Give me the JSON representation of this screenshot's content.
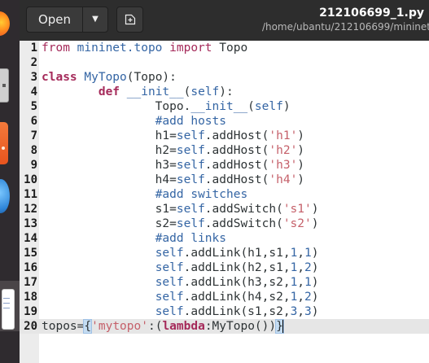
{
  "header": {
    "open_label": "Open",
    "open_dropdown_icon": "chevron-down-icon",
    "new_tab_icon": "new-document-icon",
    "file_title": "212106699_1.py",
    "file_path": "/home/ubantu/212106699/mininet"
  },
  "dock": {
    "items": [
      "firefox-icon",
      "files-icon",
      "software-center-icon",
      "help-icon",
      "text-editor-icon"
    ]
  },
  "colors": {
    "header_bg": "#2d2d2d",
    "dock_bg": "#2f2b2f",
    "keyword": "#a52a5a",
    "identifier_blue": "#3465a4",
    "string": "#c5606a",
    "current_line": "#e6e6e6"
  },
  "editor": {
    "current_line": 20,
    "lines": [
      {
        "num": "1",
        "tokens": [
          {
            "t": "from",
            "c": "imp"
          },
          {
            "t": " mininet.topo ",
            "c": "blue"
          },
          {
            "t": "import",
            "c": "imp"
          },
          {
            "t": " Topo",
            "c": "plain"
          }
        ]
      },
      {
        "num": "2",
        "tokens": []
      },
      {
        "num": "3",
        "tokens": [
          {
            "t": "class",
            "c": "kw"
          },
          {
            "t": " ",
            "c": "plain"
          },
          {
            "t": "MyTopo",
            "c": "blue"
          },
          {
            "t": "(Topo):",
            "c": "plain"
          }
        ]
      },
      {
        "num": "4",
        "tokens": [
          {
            "t": "\t",
            "c": "plain"
          },
          {
            "t": "def",
            "c": "kw"
          },
          {
            "t": " ",
            "c": "plain"
          },
          {
            "t": "__init__",
            "c": "blue"
          },
          {
            "t": "(",
            "c": "plain"
          },
          {
            "t": "self",
            "c": "blue"
          },
          {
            "t": "):",
            "c": "plain"
          }
        ]
      },
      {
        "num": "5",
        "tokens": [
          {
            "t": "\t\tTopo.",
            "c": "plain"
          },
          {
            "t": "__init__",
            "c": "blue"
          },
          {
            "t": "(",
            "c": "plain"
          },
          {
            "t": "self",
            "c": "blue"
          },
          {
            "t": ")",
            "c": "plain"
          }
        ]
      },
      {
        "num": "6",
        "tokens": [
          {
            "t": "\t\t",
            "c": "plain"
          },
          {
            "t": "#add hosts",
            "c": "com"
          }
        ]
      },
      {
        "num": "7",
        "tokens": [
          {
            "t": "\t\th1=",
            "c": "plain"
          },
          {
            "t": "self",
            "c": "blue"
          },
          {
            "t": ".addHost(",
            "c": "plain"
          },
          {
            "t": "'h1'",
            "c": "str"
          },
          {
            "t": ")",
            "c": "plain"
          }
        ]
      },
      {
        "num": "8",
        "tokens": [
          {
            "t": "\t\th2=",
            "c": "plain"
          },
          {
            "t": "self",
            "c": "blue"
          },
          {
            "t": ".addHost(",
            "c": "plain"
          },
          {
            "t": "'h2'",
            "c": "str"
          },
          {
            "t": ")",
            "c": "plain"
          }
        ]
      },
      {
        "num": "9",
        "tokens": [
          {
            "t": "\t\th3=",
            "c": "plain"
          },
          {
            "t": "self",
            "c": "blue"
          },
          {
            "t": ".addHost(",
            "c": "plain"
          },
          {
            "t": "'h3'",
            "c": "str"
          },
          {
            "t": ")",
            "c": "plain"
          }
        ]
      },
      {
        "num": "10",
        "tokens": [
          {
            "t": "\t\th4=",
            "c": "plain"
          },
          {
            "t": "self",
            "c": "blue"
          },
          {
            "t": ".addHost(",
            "c": "plain"
          },
          {
            "t": "'h4'",
            "c": "str"
          },
          {
            "t": ")",
            "c": "plain"
          }
        ]
      },
      {
        "num": "11",
        "tokens": [
          {
            "t": "\t\t",
            "c": "plain"
          },
          {
            "t": "#add switches",
            "c": "com"
          }
        ]
      },
      {
        "num": "12",
        "tokens": [
          {
            "t": "\t\ts1=",
            "c": "plain"
          },
          {
            "t": "self",
            "c": "blue"
          },
          {
            "t": ".addSwitch(",
            "c": "plain"
          },
          {
            "t": "'s1'",
            "c": "str"
          },
          {
            "t": ")",
            "c": "plain"
          }
        ]
      },
      {
        "num": "13",
        "tokens": [
          {
            "t": "\t\ts2=",
            "c": "plain"
          },
          {
            "t": "self",
            "c": "blue"
          },
          {
            "t": ".addSwitch(",
            "c": "plain"
          },
          {
            "t": "'s2'",
            "c": "str"
          },
          {
            "t": ")",
            "c": "plain"
          }
        ]
      },
      {
        "num": "14",
        "tokens": [
          {
            "t": "\t\t",
            "c": "plain"
          },
          {
            "t": "#add links",
            "c": "com"
          }
        ]
      },
      {
        "num": "15",
        "tokens": [
          {
            "t": "\t\t",
            "c": "plain"
          },
          {
            "t": "self",
            "c": "blue"
          },
          {
            "t": ".addLink(h1,s1,",
            "c": "plain"
          },
          {
            "t": "1",
            "c": "blue"
          },
          {
            "t": ",",
            "c": "plain"
          },
          {
            "t": "1",
            "c": "blue"
          },
          {
            "t": ")",
            "c": "plain"
          }
        ]
      },
      {
        "num": "16",
        "tokens": [
          {
            "t": "\t\t",
            "c": "plain"
          },
          {
            "t": "self",
            "c": "blue"
          },
          {
            "t": ".addLink(h2,s1,",
            "c": "plain"
          },
          {
            "t": "1",
            "c": "blue"
          },
          {
            "t": ",",
            "c": "plain"
          },
          {
            "t": "2",
            "c": "blue"
          },
          {
            "t": ")",
            "c": "plain"
          }
        ]
      },
      {
        "num": "17",
        "tokens": [
          {
            "t": "\t\t",
            "c": "plain"
          },
          {
            "t": "self",
            "c": "blue"
          },
          {
            "t": ".addLink(h3,s2,",
            "c": "plain"
          },
          {
            "t": "1",
            "c": "blue"
          },
          {
            "t": ",",
            "c": "plain"
          },
          {
            "t": "1",
            "c": "blue"
          },
          {
            "t": ")",
            "c": "plain"
          }
        ]
      },
      {
        "num": "18",
        "tokens": [
          {
            "t": "\t\t",
            "c": "plain"
          },
          {
            "t": "self",
            "c": "blue"
          },
          {
            "t": ".addLink(h4,s2,",
            "c": "plain"
          },
          {
            "t": "1",
            "c": "blue"
          },
          {
            "t": ",",
            "c": "plain"
          },
          {
            "t": "2",
            "c": "blue"
          },
          {
            "t": ")",
            "c": "plain"
          }
        ]
      },
      {
        "num": "19",
        "tokens": [
          {
            "t": "\t\t",
            "c": "plain"
          },
          {
            "t": "self",
            "c": "blue"
          },
          {
            "t": ".addLink(s1,s2,",
            "c": "plain"
          },
          {
            "t": "3",
            "c": "blue"
          },
          {
            "t": ",",
            "c": "plain"
          },
          {
            "t": "3",
            "c": "blue"
          },
          {
            "t": ")",
            "c": "plain"
          }
        ]
      },
      {
        "num": "20",
        "tokens": [
          {
            "t": "topos=",
            "c": "plain"
          },
          {
            "t": "{",
            "c": "br"
          },
          {
            "t": "'mytopo'",
            "c": "str"
          },
          {
            "t": ":(",
            "c": "plain"
          },
          {
            "t": "lambda",
            "c": "kw"
          },
          {
            "t": ":MyTopo())",
            "c": "plain"
          },
          {
            "t": "}",
            "c": "br"
          }
        ]
      }
    ]
  }
}
